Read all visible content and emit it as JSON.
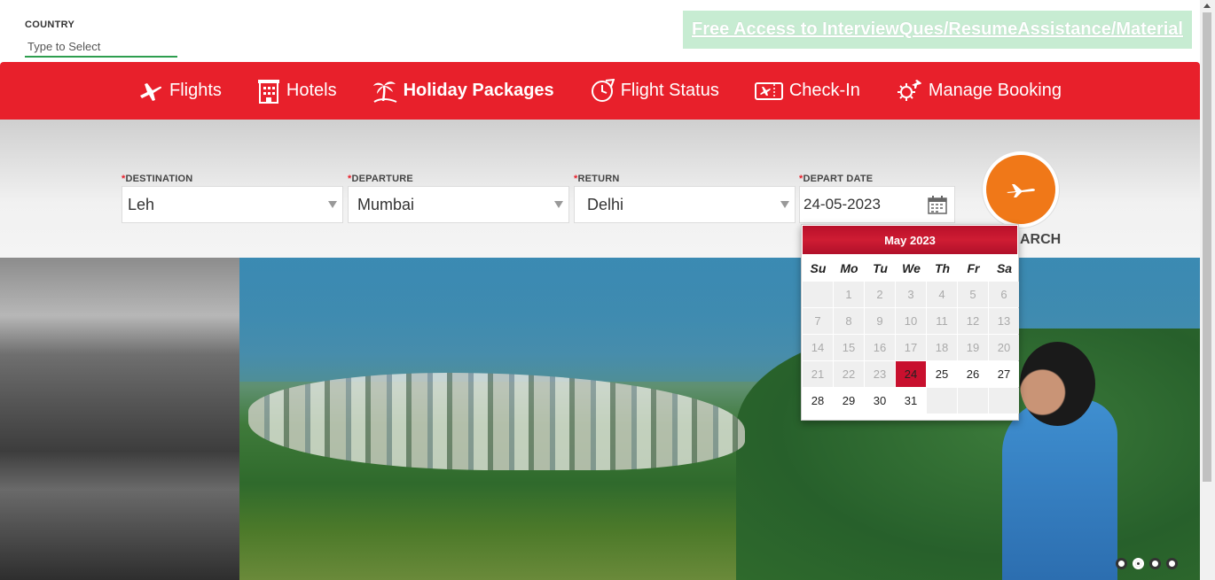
{
  "country": {
    "label": "COUNTRY",
    "placeholder": "Type to Select"
  },
  "promo": {
    "text": "Free Access to InterviewQues/ResumeAssistance/Material"
  },
  "nav": {
    "items": [
      {
        "label": "Flights",
        "icon": "plane-icon"
      },
      {
        "label": "Hotels",
        "icon": "hotel-icon"
      },
      {
        "label": "Holiday Packages",
        "icon": "palm-tree-icon",
        "active": true
      },
      {
        "label": "Flight Status",
        "icon": "clock-plane-icon"
      },
      {
        "label": "Check-In",
        "icon": "ticket-icon"
      },
      {
        "label": "Manage Booking",
        "icon": "cog-plane-icon"
      }
    ]
  },
  "form": {
    "destination": {
      "label": "DESTINATION",
      "value": "Leh"
    },
    "departure": {
      "label": "DEPARTURE",
      "value": "Mumbai"
    },
    "return": {
      "label": "RETURN",
      "value": "Delhi"
    },
    "depart_date": {
      "label": "DEPART DATE",
      "value": "24-05-2023"
    },
    "required_mark": "*",
    "search_label": "ARCH"
  },
  "calendar": {
    "month_title": "May 2023",
    "weekdays": [
      "Su",
      "Mo",
      "Tu",
      "We",
      "Th",
      "Fr",
      "Sa"
    ],
    "selected_day": "24",
    "weeks": [
      [
        "",
        "1",
        "2",
        "3",
        "4",
        "5",
        "6"
      ],
      [
        "7",
        "8",
        "9",
        "10",
        "11",
        "12",
        "13"
      ],
      [
        "14",
        "15",
        "16",
        "17",
        "18",
        "19",
        "20"
      ],
      [
        "21",
        "22",
        "23",
        "24",
        "25",
        "26",
        "27"
      ],
      [
        "28",
        "29",
        "30",
        "31",
        "",
        "",
        ""
      ]
    ],
    "first_enabled_day": 24
  },
  "carousel": {
    "dot_count": 4,
    "active_index": 1
  },
  "colors": {
    "brand_red": "#e8202b",
    "search_orange": "#f07818",
    "selected_red": "#c8102e",
    "promo_bg": "#c7ecd2",
    "underline_green": "#2e9e4f"
  }
}
